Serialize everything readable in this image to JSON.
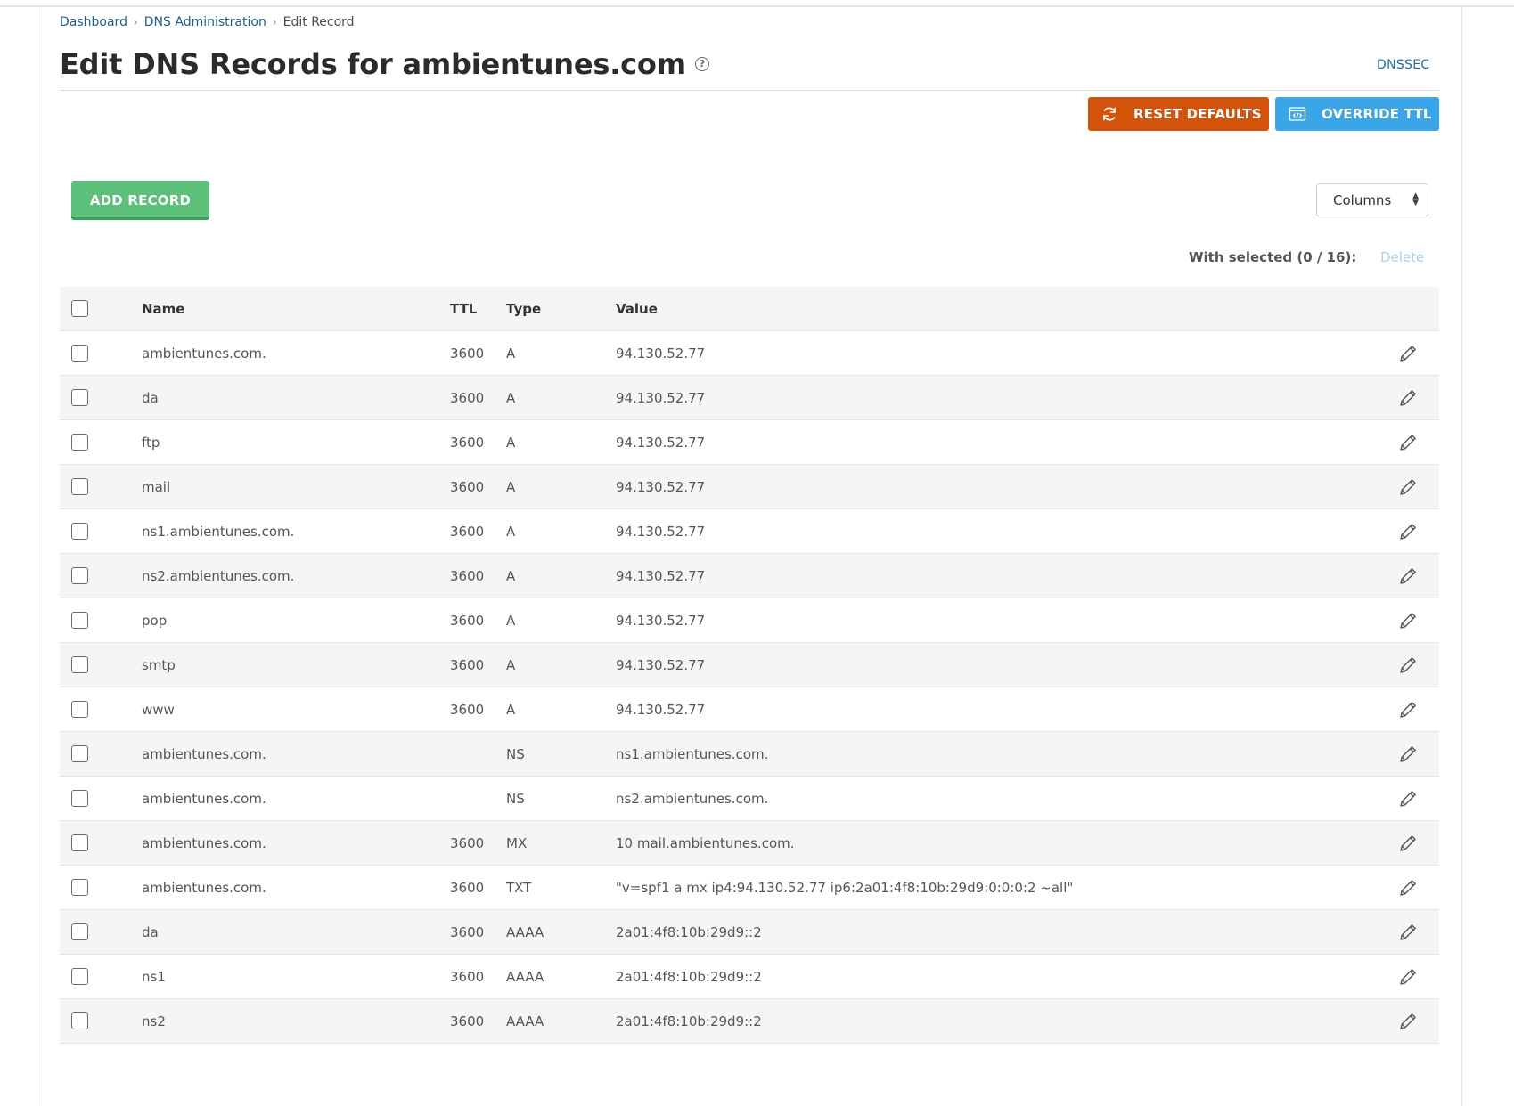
{
  "breadcrumb": {
    "items": [
      "Dashboard",
      "DNS Administration",
      "Edit Record"
    ]
  },
  "page": {
    "title": "Edit DNS Records for ambientunes.com",
    "help_icon": "question-circle-icon",
    "dnssec_link": "DNSSEC"
  },
  "toolbar": {
    "reset_label": "RESET DEFAULTS",
    "reset_icon": "refresh-icon",
    "reset_color": "#d4530b",
    "override_label": "OVERRIDE TTL",
    "override_icon": "code-window-icon",
    "override_color": "#3aa6e8",
    "add_label": "ADD RECORD",
    "add_color": "#5cbf7a",
    "columns_label": "Columns"
  },
  "selection": {
    "with_selected": "With selected (0 / 16):",
    "delete_label": "Delete"
  },
  "table": {
    "headers": {
      "name": "Name",
      "ttl": "TTL",
      "type": "Type",
      "value": "Value"
    },
    "rows": [
      {
        "name": "ambientunes.com.",
        "ttl": "3600",
        "type": "A",
        "value": "94.130.52.77"
      },
      {
        "name": "da",
        "ttl": "3600",
        "type": "A",
        "value": "94.130.52.77"
      },
      {
        "name": "ftp",
        "ttl": "3600",
        "type": "A",
        "value": "94.130.52.77"
      },
      {
        "name": "mail",
        "ttl": "3600",
        "type": "A",
        "value": "94.130.52.77"
      },
      {
        "name": "ns1.ambientunes.com.",
        "ttl": "3600",
        "type": "A",
        "value": "94.130.52.77"
      },
      {
        "name": "ns2.ambientunes.com.",
        "ttl": "3600",
        "type": "A",
        "value": "94.130.52.77"
      },
      {
        "name": "pop",
        "ttl": "3600",
        "type": "A",
        "value": "94.130.52.77"
      },
      {
        "name": "smtp",
        "ttl": "3600",
        "type": "A",
        "value": "94.130.52.77"
      },
      {
        "name": "www",
        "ttl": "3600",
        "type": "A",
        "value": "94.130.52.77"
      },
      {
        "name": "ambientunes.com.",
        "ttl": "",
        "type": "NS",
        "value": "ns1.ambientunes.com."
      },
      {
        "name": "ambientunes.com.",
        "ttl": "",
        "type": "NS",
        "value": "ns2.ambientunes.com."
      },
      {
        "name": "ambientunes.com.",
        "ttl": "3600",
        "type": "MX",
        "value": "10 mail.ambientunes.com."
      },
      {
        "name": "ambientunes.com.",
        "ttl": "3600",
        "type": "TXT",
        "value": "\"v=spf1 a mx ip4:94.130.52.77 ip6:2a01:4f8:10b:29d9:0:0:0:2 ~all\""
      },
      {
        "name": "da",
        "ttl": "3600",
        "type": "AAAA",
        "value": "2a01:4f8:10b:29d9::2"
      },
      {
        "name": "ns1",
        "ttl": "3600",
        "type": "AAAA",
        "value": "2a01:4f8:10b:29d9::2"
      },
      {
        "name": "ns2",
        "ttl": "3600",
        "type": "AAAA",
        "value": "2a01:4f8:10b:29d9::2"
      }
    ]
  }
}
